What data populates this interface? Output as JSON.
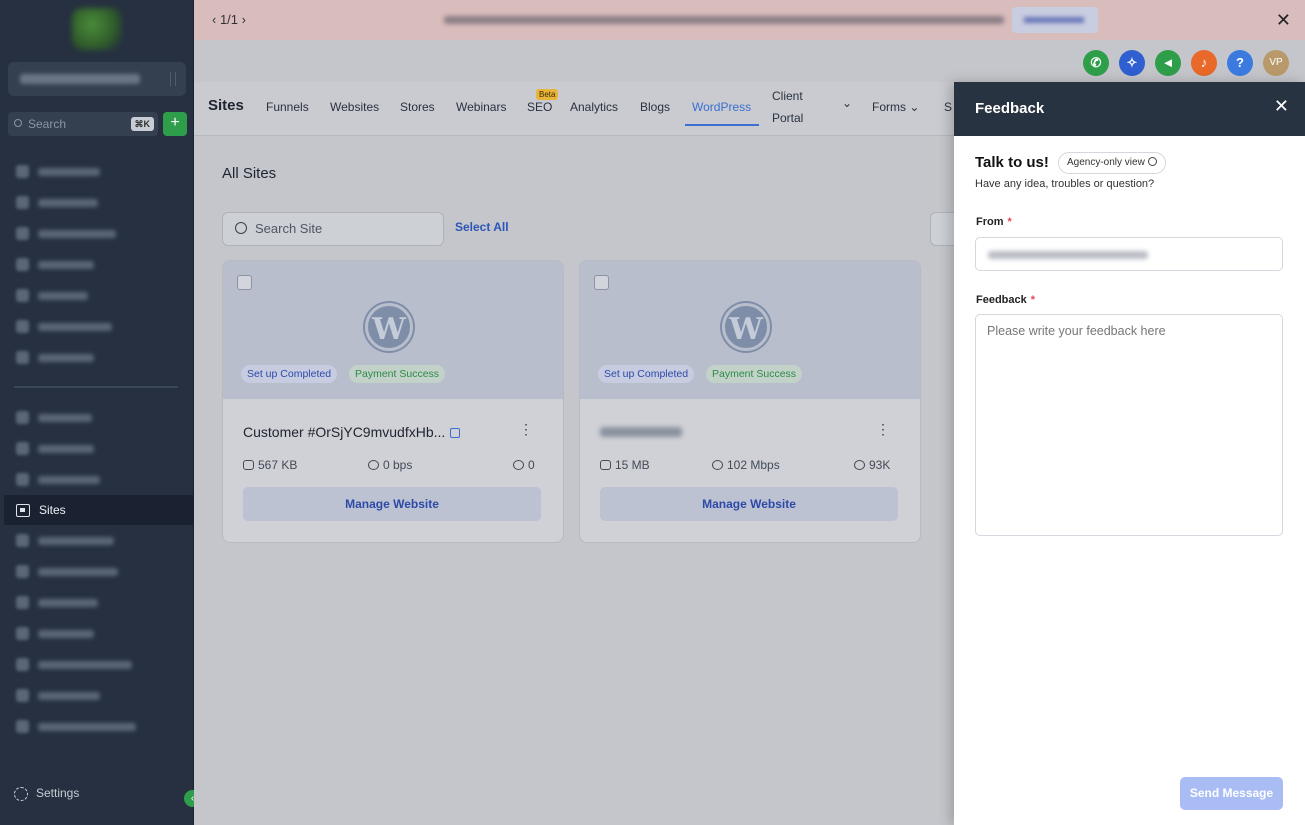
{
  "banner": {
    "pager": "‹  1/1  ›",
    "close": "✕"
  },
  "sidebar": {
    "search_placeholder": "Search",
    "search_shortcut": "⌘K",
    "add_label": "+",
    "active_item": "Sites",
    "settings_label": "Settings",
    "collapse_label": "‹"
  },
  "header": {
    "title": "Sites",
    "tabs": [
      {
        "label": "Funnels"
      },
      {
        "label": "Websites"
      },
      {
        "label": "Stores"
      },
      {
        "label": "Webinars"
      },
      {
        "label": "SEO",
        "badge": "Beta"
      },
      {
        "label": "Analytics"
      },
      {
        "label": "Blogs"
      },
      {
        "label": "WordPress",
        "active": true
      },
      {
        "label": "Client"
      },
      {
        "label": "Portal"
      },
      {
        "label": "⌄"
      },
      {
        "label": "Forms ⌄"
      },
      {
        "label": "S"
      }
    ],
    "icons": [
      {
        "name": "phone-icon",
        "color": "#2f9e4a",
        "glyph": "✆"
      },
      {
        "name": "magic-icon",
        "color": "#2f5fd0",
        "glyph": "✧"
      },
      {
        "name": "megaphone-icon",
        "color": "#2f9e4a",
        "glyph": "◄"
      },
      {
        "name": "bell-icon",
        "color": "#e8692a",
        "glyph": "♪"
      },
      {
        "name": "help-icon",
        "color": "#3b7be0",
        "glyph": "?"
      },
      {
        "name": "avatar",
        "color": "#b89a6a",
        "glyph": "VP"
      }
    ]
  },
  "content": {
    "heading": "All Sites",
    "search_placeholder": "Search Site",
    "select_all": "Select All"
  },
  "cards": [
    {
      "logo": "W",
      "status_badge": "Set up Completed",
      "payment_badge": "Payment Success",
      "name": "Customer #OrSjYC9mvudfxHb...",
      "storage": "567 KB",
      "bandwidth": "0 bps",
      "views": "0",
      "manage_label": "Manage Website",
      "more": "⋮"
    },
    {
      "logo": "W",
      "status_badge": "Set up Completed",
      "payment_badge": "Payment Success",
      "storage": "15 MB",
      "bandwidth": "102 Mbps",
      "views": "93K",
      "manage_label": "Manage Website",
      "more": "⋮"
    }
  ],
  "feedback": {
    "title": "Feedback",
    "close": "✕",
    "talk": "Talk to us!",
    "agency_badge": "Agency-only view",
    "subtitle": "Have any idea, troubles or question?",
    "from_label": "From",
    "feedback_label": "Feedback",
    "required_mark": "*",
    "placeholder": "Please write your feedback here",
    "send_label": "Send Message"
  }
}
